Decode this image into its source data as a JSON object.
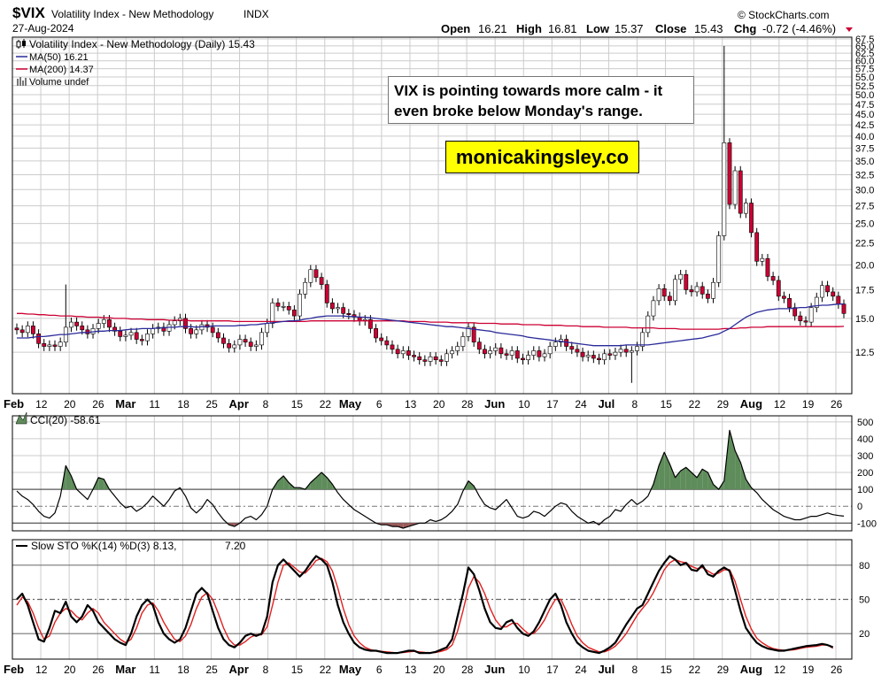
{
  "header": {
    "symbol": "$VIX",
    "name": "Volatility Index - New Methodology",
    "exchange": "INDX",
    "date": "27-Aug-2024",
    "source": "© StockCharts.com",
    "open_label": "Open",
    "open": "16.21",
    "high_label": "High",
    "high": "16.81",
    "low_label": "Low",
    "low": "15.37",
    "close_label": "Close",
    "close": "15.43",
    "chg_label": "Chg",
    "chg": "-0.72 (-4.46%)"
  },
  "legend": {
    "main": "Volatility Index - New Methodology (Daily) 15.43",
    "ma50": "MA(50) 16.21",
    "ma200": "MA(200) 14.37",
    "volume": "Volume undef",
    "cci": "CCI(20) -58.61",
    "sto_main": "Slow STO %K(14) %D(3) 8.13,",
    "sto_d": "7.20"
  },
  "annotation": "VIX is pointing towards more calm - it even broke below Monday's range.",
  "watermark": "monicakingsley.co",
  "colors": {
    "up": "#ffffff",
    "down": "#cc0033",
    "ma50": "#2a2a9a",
    "ma200": "#cc0033",
    "cci_fill_pos": "#5e8c5a",
    "cci_fill_neg": "#9a5a5a",
    "grid": "#cccccc"
  },
  "chart_data": [
    {
      "type": "candlestick",
      "title": "$VIX Volatility Index - New Methodology INDX",
      "scale": "log",
      "y_ticks": [
        "12.5",
        "15.0",
        "17.5",
        "20.0",
        "22.5",
        "25.0",
        "27.5",
        "30.0",
        "32.5",
        "35.0",
        "37.5",
        "40.0",
        "42.5",
        "45.0",
        "47.5",
        "50.0",
        "52.5",
        "55.0",
        "57.5",
        "60.0",
        "62.5",
        "65.0",
        "67.5"
      ],
      "x_ticks": [
        "Feb",
        "12",
        "20",
        "26",
        "Mar",
        "11",
        "18",
        "25",
        "Apr",
        "8",
        "15",
        "22",
        "May",
        "6",
        "13",
        "20",
        "28",
        "Jun",
        "10",
        "17",
        "24",
        "Jul",
        "8",
        "15",
        "22",
        "29",
        "Aug",
        "12",
        "19",
        "26"
      ],
      "x_tick_bold": [
        true,
        false,
        false,
        false,
        true,
        false,
        false,
        false,
        true,
        false,
        false,
        false,
        true,
        false,
        false,
        false,
        false,
        true,
        false,
        false,
        false,
        true,
        false,
        false,
        false,
        false,
        true,
        false,
        false,
        false
      ],
      "close": [
        14.1,
        13.9,
        14.4,
        13.8,
        13.1,
        12.9,
        13.0,
        12.9,
        13.2,
        14.3,
        14.7,
        14.4,
        14.1,
        13.8,
        14.2,
        14.6,
        14.9,
        14.3,
        14.0,
        13.6,
        13.7,
        13.9,
        13.4,
        13.3,
        13.8,
        14.2,
        14.3,
        14.0,
        14.5,
        14.8,
        15.0,
        14.2,
        13.8,
        14.1,
        14.5,
        14.3,
        13.9,
        13.5,
        13.1,
        12.8,
        13.0,
        13.4,
        13.2,
        12.9,
        13.0,
        13.9,
        14.6,
        16.3,
        16.0,
        16.0,
        15.7,
        15.2,
        17.1,
        18.2,
        19.5,
        18.7,
        18.0,
        16.3,
        15.8,
        15.9,
        15.4,
        15.3,
        15.1,
        14.8,
        14.9,
        14.2,
        13.5,
        13.3,
        13.0,
        12.7,
        12.4,
        12.6,
        12.3,
        12.2,
        12.0,
        11.9,
        12.2,
        12.0,
        11.9,
        12.4,
        12.6,
        12.9,
        13.6,
        14.3,
        13.2,
        12.7,
        12.4,
        12.6,
        12.8,
        12.4,
        12.3,
        12.6,
        12.1,
        12.0,
        12.3,
        12.6,
        12.2,
        12.4,
        12.9,
        13.2,
        13.4,
        12.9,
        12.7,
        12.5,
        12.2,
        12.3,
        12.1,
        12.0,
        12.4,
        12.3,
        12.5,
        12.7,
        12.5,
        12.6,
        12.9,
        13.9,
        15.2,
        16.5,
        17.6,
        16.9,
        16.5,
        18.5,
        19.0,
        17.5,
        17.3,
        17.8,
        17.1,
        16.7,
        18.2,
        23.4,
        38.6,
        27.7,
        33.2,
        26.4,
        27.9,
        23.8,
        20.4,
        20.7,
        18.8,
        18.4,
        16.9,
        16.7,
        15.9,
        15.2,
        14.8,
        14.7,
        15.9,
        16.8,
        17.9,
        17.3,
        16.9,
        16.2,
        15.4
      ],
      "ma50": [
        13.5,
        13.5,
        13.5,
        13.55,
        13.6,
        13.6,
        13.65,
        13.7,
        13.75,
        13.75,
        13.8,
        13.85,
        13.9,
        13.9,
        13.95,
        14.0,
        14.0,
        14.05,
        14.05,
        14.05,
        14.1,
        14.15,
        14.15,
        14.2,
        14.2,
        14.2,
        14.25,
        14.25,
        14.3,
        14.3,
        14.35,
        14.35,
        14.35,
        14.3,
        14.35,
        14.35,
        14.4,
        14.4,
        14.4,
        14.4,
        14.4,
        14.45,
        14.45,
        14.5,
        14.5,
        14.55,
        14.6,
        14.65,
        14.7,
        14.75,
        14.8,
        14.8,
        14.85,
        14.95,
        15.0,
        15.1,
        15.15,
        15.2,
        15.2,
        15.2,
        15.2,
        15.15,
        15.15,
        15.1,
        15.1,
        15.05,
        15.0,
        14.95,
        14.9,
        14.85,
        14.8,
        14.75,
        14.7,
        14.65,
        14.6,
        14.55,
        14.5,
        14.45,
        14.4,
        14.35,
        14.35,
        14.3,
        14.25,
        14.2,
        14.15,
        14.1,
        14.05,
        14.0,
        13.9,
        13.85,
        13.8,
        13.75,
        13.7,
        13.65,
        13.55,
        13.5,
        13.45,
        13.4,
        13.35,
        13.3,
        13.25,
        13.2,
        13.15,
        13.1,
        13.05,
        13.0,
        12.95,
        12.95,
        12.95,
        12.95,
        12.95,
        12.95,
        13.0,
        13.0,
        13.0,
        13.0,
        13.0,
        13.05,
        13.1,
        13.15,
        13.2,
        13.25,
        13.3,
        13.35,
        13.4,
        13.45,
        13.5,
        13.6,
        13.7,
        13.8,
        14.0,
        14.2,
        14.5,
        14.8,
        15.1,
        15.3,
        15.5,
        15.6,
        15.7,
        15.75,
        15.8,
        15.8,
        15.8,
        15.85,
        15.9,
        15.9,
        16.0,
        16.05,
        16.1,
        16.1,
        16.15,
        16.2,
        16.2
      ],
      "ma200": [
        15.4,
        15.4,
        15.35,
        15.35,
        15.3,
        15.3,
        15.25,
        15.25,
        15.2,
        15.2,
        15.2,
        15.15,
        15.15,
        15.1,
        15.1,
        15.1,
        15.05,
        15.05,
        15.0,
        15.0,
        15.0,
        14.95,
        14.95,
        14.95,
        14.9,
        14.9,
        14.9,
        14.9,
        14.85,
        14.85,
        14.85,
        14.85,
        14.8,
        14.8,
        14.8,
        14.8,
        14.8,
        14.8,
        14.8,
        14.8,
        14.75,
        14.75,
        14.75,
        14.75,
        14.75,
        14.75,
        14.75,
        14.75,
        14.75,
        14.75,
        14.75,
        14.75,
        14.75,
        14.75,
        14.8,
        14.8,
        14.8,
        14.8,
        14.8,
        14.8,
        14.8,
        14.8,
        14.8,
        14.8,
        14.8,
        14.8,
        14.8,
        14.8,
        14.8,
        14.8,
        14.8,
        14.8,
        14.75,
        14.75,
        14.75,
        14.75,
        14.7,
        14.7,
        14.7,
        14.7,
        14.65,
        14.65,
        14.65,
        14.65,
        14.65,
        14.6,
        14.6,
        14.6,
        14.6,
        14.55,
        14.55,
        14.55,
        14.55,
        14.5,
        14.5,
        14.5,
        14.5,
        14.45,
        14.45,
        14.45,
        14.45,
        14.4,
        14.4,
        14.4,
        14.35,
        14.35,
        14.35,
        14.35,
        14.3,
        14.3,
        14.3,
        14.3,
        14.3,
        14.25,
        14.25,
        14.25,
        14.25,
        14.25,
        14.2,
        14.2,
        14.2,
        14.2,
        14.15,
        14.15,
        14.15,
        14.15,
        14.15,
        14.15,
        14.15,
        14.15,
        14.2,
        14.2,
        14.2,
        14.25,
        14.25,
        14.3,
        14.3,
        14.3,
        14.35,
        14.35,
        14.35,
        14.35,
        14.35,
        14.35,
        14.35,
        14.35,
        14.35,
        14.35,
        14.35,
        14.35,
        14.35,
        14.35,
        14.37
      ]
    },
    {
      "type": "line",
      "title": "CCI(20)",
      "y_ticks": [
        "500",
        "400",
        "300",
        "200",
        "100",
        "0",
        "-100"
      ],
      "ylim": [
        -130,
        520
      ],
      "values": [
        90,
        60,
        40,
        10,
        -30,
        -60,
        -70,
        -40,
        60,
        240,
        180,
        100,
        70,
        40,
        100,
        170,
        160,
        100,
        60,
        20,
        -10,
        0,
        -30,
        -10,
        20,
        60,
        30,
        0,
        40,
        90,
        110,
        60,
        -10,
        -40,
        -10,
        40,
        10,
        -40,
        -80,
        -110,
        -120,
        -100,
        -70,
        -60,
        -80,
        -50,
        0,
        100,
        150,
        180,
        140,
        110,
        110,
        100,
        140,
        170,
        200,
        170,
        130,
        80,
        40,
        10,
        -20,
        -40,
        -60,
        -80,
        -100,
        -110,
        -110,
        -120,
        -120,
        -130,
        -120,
        -110,
        -100,
        -100,
        -80,
        -90,
        -80,
        -60,
        -30,
        10,
        90,
        150,
        120,
        60,
        10,
        -10,
        -20,
        10,
        40,
        -10,
        -60,
        -70,
        -60,
        -30,
        -40,
        -60,
        -30,
        0,
        20,
        10,
        -30,
        -60,
        -80,
        -100,
        -90,
        -110,
        -80,
        -60,
        -20,
        -30,
        10,
        40,
        10,
        30,
        60,
        130,
        240,
        320,
        250,
        170,
        210,
        230,
        200,
        170,
        220,
        200,
        130,
        100,
        150,
        450,
        330,
        260,
        160,
        110,
        80,
        40,
        10,
        -20,
        -40,
        -60,
        -70,
        -80,
        -80,
        -70,
        -60,
        -60,
        -50,
        -40,
        -50,
        -55,
        -58.61
      ]
    },
    {
      "type": "line",
      "title": "Slow STO %K(14) %D(3)",
      "y_ticks": [
        "80",
        "50",
        "20"
      ],
      "ylim": [
        0,
        100
      ],
      "series": [
        {
          "name": "%K(14)",
          "values": [
            50,
            55,
            45,
            30,
            15,
            13,
            25,
            40,
            38,
            48,
            35,
            30,
            35,
            45,
            40,
            30,
            25,
            20,
            15,
            12,
            10,
            20,
            35,
            45,
            50,
            45,
            30,
            20,
            15,
            12,
            15,
            25,
            40,
            55,
            60,
            55,
            40,
            25,
            15,
            10,
            8,
            12,
            18,
            20,
            18,
            20,
            35,
            65,
            80,
            85,
            80,
            75,
            70,
            75,
            82,
            88,
            85,
            80,
            65,
            45,
            30,
            20,
            12,
            8,
            6,
            5,
            5,
            4,
            3,
            3,
            3,
            4,
            5,
            5,
            3,
            3,
            3,
            4,
            6,
            8,
            15,
            35,
            55,
            78,
            72,
            58,
            42,
            30,
            25,
            24,
            30,
            32,
            25,
            20,
            18,
            22,
            30,
            40,
            50,
            55,
            45,
            30,
            20,
            12,
            8,
            5,
            4,
            3,
            5,
            8,
            12,
            20,
            28,
            35,
            42,
            45,
            55,
            65,
            75,
            82,
            88,
            85,
            80,
            82,
            76,
            75,
            80,
            72,
            70,
            75,
            78,
            75,
            58,
            40,
            25,
            18,
            12,
            9,
            7,
            6,
            5,
            5,
            6,
            7,
            8,
            9,
            9.5,
            10,
            11,
            10,
            8.13
          ]
        },
        {
          "name": "%D(3)",
          "values": [
            45,
            52,
            48,
            38,
            25,
            15,
            18,
            30,
            38,
            42,
            40,
            35,
            32,
            38,
            42,
            38,
            30,
            25,
            20,
            15,
            12,
            15,
            25,
            38,
            45,
            47,
            40,
            30,
            22,
            15,
            13,
            18,
            28,
            42,
            52,
            56,
            50,
            38,
            25,
            15,
            10,
            10,
            13,
            17,
            19,
            19,
            26,
            45,
            65,
            80,
            82,
            78,
            74,
            73,
            78,
            84,
            86,
            83,
            75,
            60,
            42,
            28,
            18,
            12,
            8,
            6,
            5,
            4.5,
            4,
            3.5,
            3,
            3.5,
            4,
            4.5,
            4,
            3.5,
            3.3,
            3.5,
            4.5,
            6,
            10,
            22,
            40,
            60,
            70,
            65,
            55,
            42,
            32,
            26,
            26,
            29,
            29,
            24,
            20,
            20,
            25,
            32,
            42,
            50,
            50,
            40,
            28,
            18,
            12,
            8,
            6,
            4,
            4,
            6,
            9,
            14,
            20,
            28,
            36,
            42,
            48,
            56,
            66,
            76,
            82,
            85,
            83,
            82,
            79,
            77,
            78,
            75,
            72,
            73,
            76,
            76,
            66,
            50,
            35,
            24,
            16,
            12,
            9,
            7,
            6,
            5.5,
            5.5,
            6,
            7,
            8,
            8.5,
            9,
            10,
            10,
            7.2
          ]
        }
      ]
    }
  ]
}
